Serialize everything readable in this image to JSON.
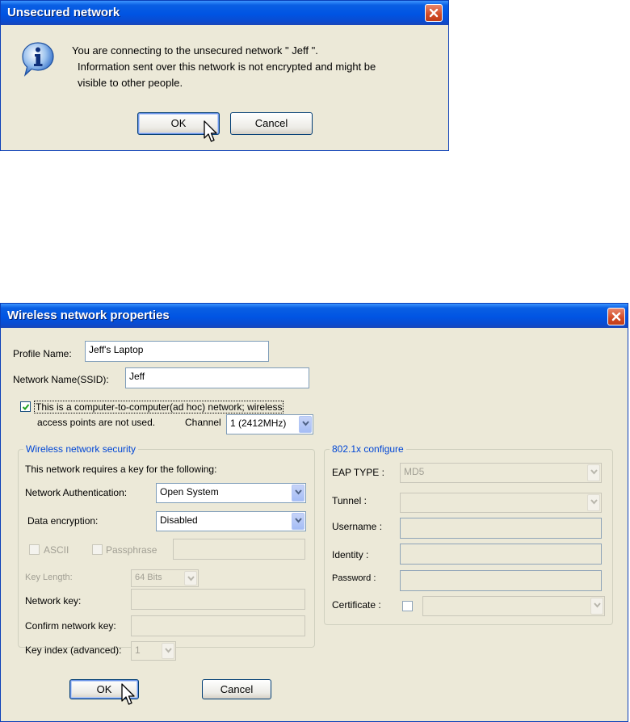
{
  "dialog1": {
    "title": "Unsecured network",
    "message_line1": "You are connecting to the unsecured network \" Jeff \".",
    "message_line2": "Information sent over this network is not encrypted and might be",
    "message_line3": "visible to other people.",
    "ok_label": "OK",
    "cancel_label": "Cancel"
  },
  "dialog2": {
    "title": "Wireless network properties",
    "profile_name_label": "Profile Name:",
    "profile_name_value": "Jeff's Laptop",
    "ssid_label": "Network Name(SSID):",
    "ssid_value": "Jeff",
    "adhoc_line1": "This is a computer-to-computer(ad hoc) network; wireless",
    "adhoc_line2": "access points are not used.",
    "adhoc_checked": true,
    "channel_label": "Channel",
    "channel_value": "1  (2412MHz)",
    "security": {
      "group_title": "Wireless network security",
      "requires_key_text": "This network requires a key for the following:",
      "auth_label": "Network Authentication:",
      "auth_value": "Open System",
      "encryption_label": "Data encryption:",
      "encryption_value": "Disabled",
      "ascii_label": "ASCII",
      "passphrase_label": "Passphrase",
      "key_length_label": "Key Length:",
      "key_length_value": "64 Bits",
      "network_key_label": "Network key:",
      "confirm_key_label": "Confirm network key:",
      "key_index_label": "Key index (advanced):",
      "key_index_value": "1"
    },
    "dot1x": {
      "group_title": "802.1x configure",
      "eap_type_label": "EAP TYPE :",
      "eap_type_value": "MD5",
      "tunnel_label": "Tunnel :",
      "username_label": "Username :",
      "identity_label": "Identity :",
      "password_label": "Password :",
      "certificate_label": "Certificate :"
    },
    "ok_label": "OK",
    "cancel_label": "Cancel"
  },
  "icons": {
    "info": "info-icon",
    "close": "close-icon",
    "cursor": "mouse-pointer-icon",
    "dropdown": "chevron-down-icon",
    "checkmark": "checkmark-icon"
  },
  "colors": {
    "titlebar": "#0054e3",
    "window_face": "#ece9d8",
    "close_button": "#d14b25",
    "group_title": "#0046d5"
  }
}
